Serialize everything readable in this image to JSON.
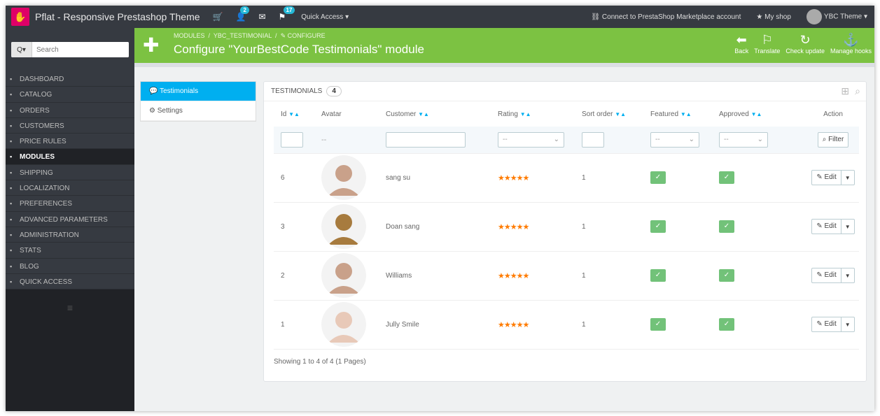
{
  "topbar": {
    "shop_name": "Pflat - Responsive Prestashop Theme",
    "cart_badge": "",
    "customers_badge": "2",
    "messages_badge": "",
    "orders_badge": "17",
    "quick_access": "Quick Access ▾",
    "connect": "Connect to PrestaShop Marketplace account",
    "my_shop": "My shop",
    "user": "YBC Theme ▾"
  },
  "sidebar": {
    "search_button": "Q▾",
    "search_placeholder": "Search",
    "items": [
      {
        "label": "DASHBOARD",
        "icon": "dashboard-icon"
      },
      {
        "label": "CATALOG",
        "icon": "catalog-icon"
      },
      {
        "label": "ORDERS",
        "icon": "orders-icon"
      },
      {
        "label": "CUSTOMERS",
        "icon": "customers-icon"
      },
      {
        "label": "PRICE RULES",
        "icon": "price-rules-icon"
      },
      {
        "label": "MODULES",
        "icon": "modules-icon",
        "active": true
      },
      {
        "label": "SHIPPING",
        "icon": "shipping-icon"
      },
      {
        "label": "LOCALIZATION",
        "icon": "localization-icon"
      },
      {
        "label": "PREFERENCES",
        "icon": "preferences-icon"
      },
      {
        "label": "ADVANCED PARAMETERS",
        "icon": "advanced-parameters-icon"
      },
      {
        "label": "ADMINISTRATION",
        "icon": "administration-icon"
      },
      {
        "label": "STATS",
        "icon": "stats-icon"
      },
      {
        "label": "BLOG",
        "icon": "blog-icon"
      },
      {
        "label": "QUICK ACCESS",
        "icon": "quick-access-icon"
      }
    ]
  },
  "header": {
    "breadcrumb_1": "MODULES",
    "breadcrumb_2": "YBC_TESTIMONIAL",
    "breadcrumb_3": "CONFIGURE",
    "title": "Configure \"YourBestCode Testimonials\" module",
    "toolbar": {
      "back": "Back",
      "translate": "Translate",
      "check_update": "Check update",
      "manage_hooks": "Manage hooks"
    }
  },
  "tabs": {
    "testimonials": "Testimonials",
    "settings": "Settings"
  },
  "panel": {
    "title": "TESTIMONIALS",
    "count": "4",
    "columns": {
      "id": "Id",
      "avatar": "Avatar",
      "customer": "Customer",
      "rating": "Rating",
      "sort_order": "Sort order",
      "featured": "Featured",
      "approved": "Approved",
      "action": "Action"
    },
    "filter": {
      "avatar_placeholder": "--",
      "rating_value": "--",
      "featured_value": "--",
      "approved_value": "--",
      "filter_button": "Filter"
    },
    "rows": [
      {
        "id": "6",
        "customer": "sang su",
        "rating": "★★★★★",
        "sort_order": "1",
        "edit": "Edit",
        "avatar_color": "#c9a18a"
      },
      {
        "id": "3",
        "customer": "Doan sang",
        "rating": "★★★★★",
        "sort_order": "1",
        "edit": "Edit",
        "avatar_color": "#a77b3e"
      },
      {
        "id": "2",
        "customer": "Williams",
        "rating": "★★★★★",
        "sort_order": "1",
        "edit": "Edit",
        "avatar_color": "#c9a18a"
      },
      {
        "id": "1",
        "customer": "Jully Smile",
        "rating": "★★★★★",
        "sort_order": "1",
        "edit": "Edit",
        "avatar_color": "#e8c9b8"
      }
    ],
    "footer": "Showing 1 to 4 of 4 (1 Pages)"
  },
  "colors": {
    "header_green": "#7cc242",
    "active_tab": "#00aff0",
    "check_green": "#72c279",
    "star_orange": "#ff7b00",
    "topbar": "#363a41"
  }
}
